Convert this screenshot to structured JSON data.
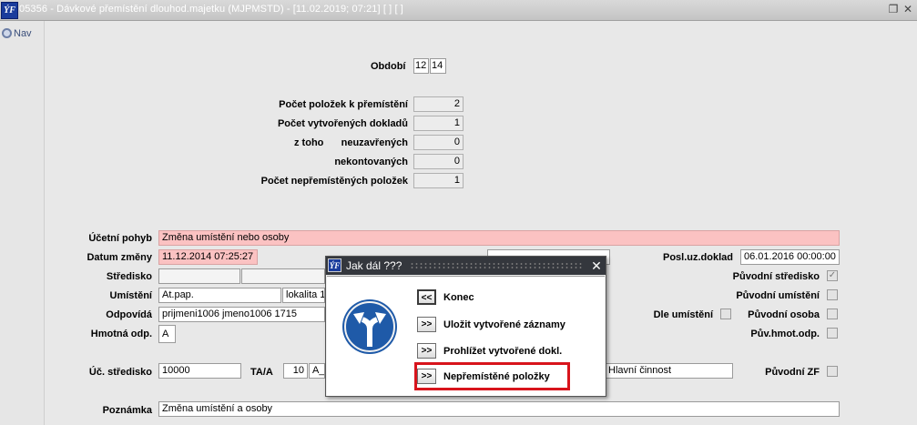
{
  "window": {
    "title": "05356 - Dávkové přemístění dlouhod.majetku (MJPMSTD) - [11.02.2019; 07:21]  [ ]  [ ]",
    "logo_text": "ÝF",
    "restore_glyph": "❐",
    "close_glyph": "✕"
  },
  "nav": {
    "label": "Nav"
  },
  "obdobi": {
    "label": "Období",
    "value_1": "12",
    "value_2": "14"
  },
  "counts": {
    "polozek_label": "Počet položek k přemístění",
    "polozek_value": "2",
    "dokladu_label": "Počet vytvořených dokladů",
    "dokladu_value": "1",
    "ztoho_label": "z toho",
    "neuzavrenych_label": "neuzavřených",
    "neuzavrenych_value": "0",
    "nekontovanych_label": "nekontovaných",
    "nekontovanych_value": "0",
    "nepremistenych_label": "Počet nepřemístěných položek",
    "nepremistenych_value": "1"
  },
  "form": {
    "ucetni_pohyb_label": "Účetní pohyb",
    "ucetni_pohyb_value": "Změna umístění nebo osoby",
    "datum_zmeny_label": "Datum změny",
    "datum_zmeny_value": "11.12.2014 07:25:27",
    "posl_uz_doklad_label": "Posl.uz.doklad",
    "posl_uz_doklad_value": "06.01.2016 00:00:00",
    "stredisko_label": "Středisko",
    "puvodni_stredisko_label": "Původní středisko",
    "umisteni_label": "Umístění",
    "umisteni_value_1": "At.pap.",
    "umisteni_value_2": "lokalita 13",
    "puvodni_umisteni_label": "Původní umístění",
    "odpovida_label": "Odpovídá",
    "odpovida_value": "prijmeni1006 jmeno1006 1715",
    "dle_umisteni_label": "Dle umístění",
    "puvodni_osoba_label": "Původní osoba",
    "hmotna_odp_label": "Hmotná odp.",
    "hmotna_odp_value": "A",
    "puv_hmot_odp_label": "Pův.hmot.odp.",
    "uct_stredisko_label": "Úč. středisko",
    "uct_stredisko_value": "10000",
    "ta_label": "TA/A",
    "ta_value_1": "10",
    "ta_value_2": "A_",
    "cinnost_value": "Hlavní činnost",
    "puvodni_zf_label": "Původní ZF",
    "poznamka_label": "Poznámka",
    "poznamka_value": "Změna umístění a osoby",
    "check_glyph": "✓"
  },
  "dialog": {
    "title": "Jak dál ???",
    "close_glyph": "✕",
    "logo_text": "ÝF",
    "buttons": [
      {
        "glyph": "<<",
        "label": "Konec"
      },
      {
        "glyph": ">>",
        "label": "Uložit vytvořené záznamy"
      },
      {
        "glyph": ">>",
        "label": "Prohlížet vytvořené dokl."
      },
      {
        "glyph": ">>",
        "label": "Nepřemístěné položky"
      }
    ]
  },
  "colors": {
    "highlight_border": "#d8141c",
    "required_field": "#fbc2c2",
    "sign_blue": "#1f5aa8",
    "dialog_header": "#34373d"
  }
}
